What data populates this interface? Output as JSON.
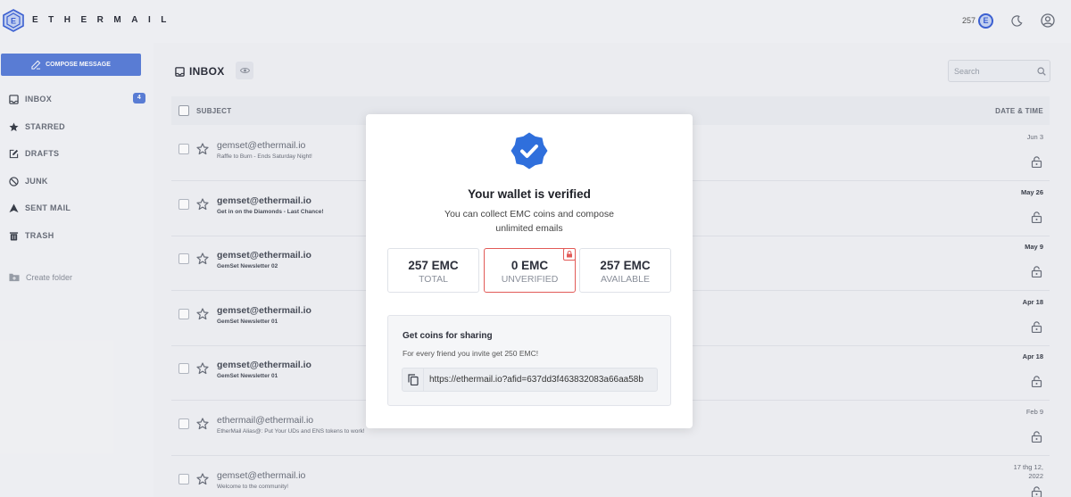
{
  "brand": {
    "name": "ETHERMAIL"
  },
  "topbar": {
    "coin_count": "257",
    "coin_symbol": "E"
  },
  "sidebar": {
    "compose_label": "COMPOSE MESSAGE",
    "items": [
      {
        "label": "INBOX",
        "badge": "4"
      },
      {
        "label": "STARRED"
      },
      {
        "label": "DRAFTS"
      },
      {
        "label": "JUNK"
      },
      {
        "label": "SENT MAIL"
      },
      {
        "label": "TRASH"
      }
    ],
    "create_folder": "Create folder"
  },
  "main": {
    "title": "INBOX",
    "search_placeholder": "Search",
    "columns": {
      "subject": "SUBJECT",
      "date": "DATE & TIME"
    },
    "emails": [
      {
        "sender": "gemset@ethermail.io",
        "subject": "Raffle to Burn - Ends Saturday Night!",
        "date": "Jun 3",
        "unread": false
      },
      {
        "sender": "gemset@ethermail.io",
        "subject": "Get in on the Diamonds - Last Chance!",
        "date": "May 26",
        "unread": true
      },
      {
        "sender": "gemset@ethermail.io",
        "subject": "GemSet Newsletter 02",
        "date": "May 9",
        "unread": true
      },
      {
        "sender": "gemset@ethermail.io",
        "subject": "GemSet Newsletter 01",
        "date": "Apr 18",
        "unread": true
      },
      {
        "sender": "gemset@ethermail.io",
        "subject": "GemSet Newsletter 01",
        "date": "Apr 18",
        "unread": true
      },
      {
        "sender": "ethermail@ethermail.io",
        "subject": "EtherMail Alias@: Put Your UDs and ENS tokens to work!",
        "date": "Feb 9",
        "unread": false
      },
      {
        "sender": "gemset@ethermail.io",
        "subject": "Welcome to the community!",
        "date": "17 thg 12, 2022",
        "unread": false
      }
    ]
  },
  "modal": {
    "title": "Your wallet is verified",
    "description": "You can collect EMC coins and compose unlimited emails",
    "stats": [
      {
        "value": "257 EMC",
        "label": "TOTAL"
      },
      {
        "value": "0 EMC",
        "label": "UNVERIFIED"
      },
      {
        "value": "257 EMC",
        "label": "AVAILABLE"
      }
    ],
    "share": {
      "title": "Get coins for sharing",
      "description": "For every friend you invite get 250 EMC!",
      "link": "https://ethermail.io?afid=637dd3f463832083a66aa58b"
    }
  },
  "colors": {
    "accent": "#5b7fd9",
    "verified_badge": "#2f6fdc",
    "unverified_border": "#e25a57"
  }
}
